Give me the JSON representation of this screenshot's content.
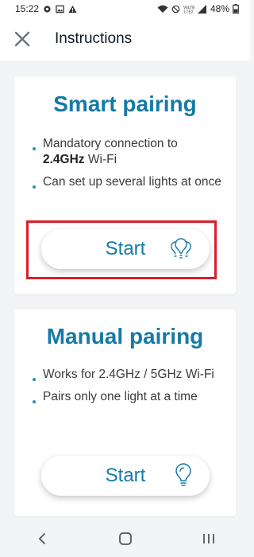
{
  "status_bar": {
    "time": "15:22",
    "battery": "48%",
    "icons_left": [
      "gear-icon",
      "image-icon",
      "warning-icon"
    ],
    "icons_right": [
      "wifi-icon",
      "mute-icon",
      "volte-icon",
      "signal-icon",
      "battery-icon"
    ]
  },
  "app_bar": {
    "title": "Instructions",
    "close_icon": "close-icon"
  },
  "smart_pairing": {
    "title": "Smart pairing",
    "bullets": {
      "b1_pre": "Mandatory connection to",
      "b1_bold": "2.4GHz",
      "b1_post": " Wi-Fi",
      "b2": "Can set up several lights at once"
    },
    "button_label": "Start",
    "button_icon": "multiple-bulbs-icon"
  },
  "manual_pairing": {
    "title": "Manual pairing",
    "bullets": {
      "b1": "Works for 2.4GHz / 5GHz Wi-Fi",
      "b2": "Pairs only one light at a time"
    },
    "button_label": "Start",
    "button_icon": "bulb-icon"
  },
  "colors": {
    "accent": "#167aa6",
    "highlight": "#d81f2a",
    "background": "#f3f4f6"
  },
  "nav_bar": {
    "icons": [
      "back-icon",
      "home-icon",
      "recents-icon"
    ]
  }
}
